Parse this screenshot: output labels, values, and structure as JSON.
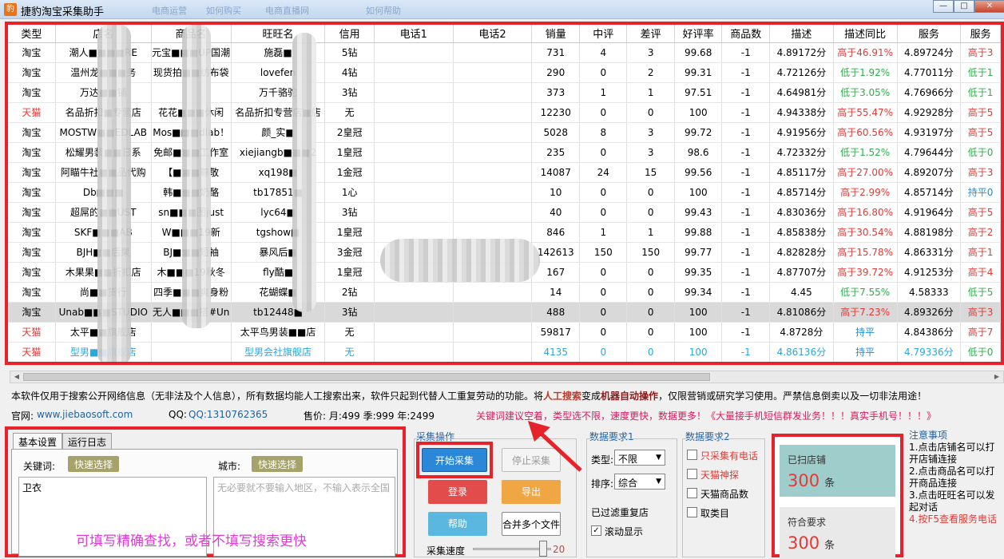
{
  "window": {
    "icon": "app-logo-icon",
    "title": "捷豹淘宝采集助手",
    "ghost_tabs": [
      "电商运营",
      "如何购买",
      "电商直播网",
      "如何帮助"
    ],
    "buttons": {
      "minimize": "—",
      "maximize": "□",
      "close": "✕"
    }
  },
  "grid": {
    "columns": [
      "类型",
      "店名",
      "商品名",
      "旺旺名",
      "信用",
      "电话1",
      "电话2",
      "销量",
      "中评",
      "差评",
      "好评率",
      "商品数",
      "描述",
      "描述同比",
      "服务",
      "服务"
    ],
    "rows": [
      {
        "type": "淘宝",
        "shop": "潮人■■■■RE",
        "product": "元宝■■■UP国潮",
        "wangwang": "施磊■",
        "credit": "5钻",
        "phone1": "",
        "phone2": "",
        "sales": "731",
        "mid": "4",
        "bad": "3",
        "rate": "99.68",
        "count": "-1",
        "desc": "4.89172分",
        "desc_cmp": "高于46.91%",
        "service": "4.89724分",
        "service_cmp": "高于3"
      },
      {
        "type": "淘宝",
        "shop": "温州龙■■■务",
        "product": "现货拍■■纺布袋",
        "wangwang": "lovefen",
        "credit": "4钻",
        "phone1": "",
        "phone2": "",
        "sales": "290",
        "mid": "0",
        "bad": "2",
        "rate": "99.31",
        "count": "-1",
        "desc": "4.72126分",
        "desc_cmp": "低于1.92%",
        "service": "4.77011分",
        "service_cmp": "低于1"
      },
      {
        "type": "淘宝",
        "shop": "万达■■铺",
        "product": "",
        "wangwang": "万千骆驼",
        "credit": "3钻",
        "phone1": "",
        "phone2": "",
        "sales": "373",
        "mid": "1",
        "bad": "1",
        "rate": "97.51",
        "count": "-1",
        "desc": "4.64981分",
        "desc_cmp": "低于3.05%",
        "service": "4.76966分",
        "service_cmp": "低于1"
      },
      {
        "type": "天猫",
        "shop": "名品折扣■专营店",
        "product": "花花■■■休闲",
        "wangwang": "名品折扣专营店■店",
        "credit": "无",
        "phone1": "",
        "phone2": "",
        "sales": "12230",
        "mid": "0",
        "bad": "0",
        "rate": "100",
        "count": "-1",
        "desc": "4.94338分",
        "desc_cmp": "高于55.47%",
        "service": "4.92928分",
        "service_cmp": "高于5"
      },
      {
        "type": "淘宝",
        "shop": "MOSTW■■EDLAB",
        "product": "Mos■■■dlab！",
        "wangwang": "颜_实■",
        "credit": "2皇冠",
        "phone1": "",
        "phone2": "",
        "sales": "5028",
        "mid": "8",
        "bad": "3",
        "rate": "99.72",
        "count": "-1",
        "desc": "4.91956分",
        "desc_cmp": "高于60.56%",
        "service": "4.93197分",
        "service_cmp": "高于5"
      },
      {
        "type": "淘宝",
        "shop": "松耀男装■■日系",
        "product": "免邮■■■工作室",
        "wangwang": "xiejiangb■■■2",
        "credit": "1皇冠",
        "phone1": "",
        "phone2": "",
        "sales": "235",
        "mid": "0",
        "bad": "3",
        "rate": "98.6",
        "count": "-1",
        "desc": "4.72332分",
        "desc_cmp": "低于1.52%",
        "service": "4.79644分",
        "service_cmp": "低于0"
      },
      {
        "type": "淘宝",
        "shop": "阿瞄牛社■■品代购",
        "product": "【■■■尊敬",
        "wangwang": "xq198■",
        "credit": "1金冠",
        "phone1": "",
        "phone2": "",
        "sales": "14087",
        "mid": "24",
        "bad": "15",
        "rate": "99.56",
        "count": "-1",
        "desc": "4.85117分",
        "desc_cmp": "高于27.00%",
        "service": "4.89207分",
        "service_cmp": "高于3"
      },
      {
        "type": "淘宝",
        "shop": "Db■■■",
        "product": "韩■■■奶酪",
        "wangwang": "tb17851■",
        "credit": "1心",
        "phone1": "",
        "phone2": "",
        "sales": "10",
        "mid": "0",
        "bad": "0",
        "rate": "100",
        "count": "-1",
        "desc": "4.85714分",
        "desc_cmp": "高于2.99%",
        "service": "4.85714分",
        "service_cmp": "持平0"
      },
      {
        "type": "淘宝",
        "shop": "超屌的■■UST",
        "product": "sn■■■图just",
        "wangwang": "lyc64■",
        "credit": "3钻",
        "phone1": "",
        "phone2": "",
        "sales": "40",
        "mid": "0",
        "bad": "0",
        "rate": "99.43",
        "count": "-1",
        "desc": "4.83036分",
        "desc_cmp": "高于16.80%",
        "service": "4.91964分",
        "service_cmp": "高于5"
      },
      {
        "type": "淘宝",
        "shop": "SKF■■■AB",
        "product": "W■■■19新",
        "wangwang": "tgshow■",
        "credit": "1皇冠",
        "phone1": "",
        "phone2": "",
        "sales": "846",
        "mid": "1",
        "bad": "1",
        "rate": "99.88",
        "count": "-1",
        "desc": "4.85838分",
        "desc_cmp": "高于30.54%",
        "service": "4.88198分",
        "service_cmp": "高于2"
      },
      {
        "type": "淘宝",
        "shop": "BJH■■后果",
        "product": "BJ■■■短袖",
        "wangwang": "暴风后■",
        "credit": "3金冠",
        "phone1": "",
        "phone2": "",
        "sales": "142613",
        "mid": "150",
        "bad": "150",
        "rate": "99.77",
        "count": "-1",
        "desc": "4.82828分",
        "desc_cmp": "高于15.78%",
        "service": "4.86331分",
        "service_cmp": "高于1"
      },
      {
        "type": "淘宝",
        "shop": "木果果■■折扣店",
        "product": "木■■■19秋冬",
        "wangwang": "fly酷■",
        "credit": "1皇冠",
        "phone1": "",
        "phone2": "",
        "sales": "167",
        "mid": "0",
        "bad": "0",
        "rate": "99.35",
        "count": "-1",
        "desc": "4.87707分",
        "desc_cmp": "高于39.72%",
        "service": "4.91253分",
        "service_cmp": "高于4"
      },
      {
        "type": "淘宝",
        "shop": "尚■■货行",
        "product": "四季■■■爽身粉",
        "wangwang": "花蝴蝶■",
        "credit": "2钻",
        "phone1": "",
        "phone2": "",
        "sales": "14",
        "mid": "0",
        "bad": "0",
        "rate": "99.34",
        "count": "-1",
        "desc": "4.45",
        "desc_cmp": "低于7.55%",
        "service": "4.58333",
        "service_cmp": "低于5"
      },
      {
        "type": "淘宝",
        "shop": "Unab■■■STUDIO",
        "product": "无人■■■搭#Un",
        "wangwang": "tb12448■",
        "credit": "3钻",
        "phone1": "",
        "phone2": "",
        "sales": "488",
        "mid": "0",
        "bad": "0",
        "rate": "100",
        "count": "-1",
        "desc": "4.81086分",
        "desc_cmp": "高于7.23%",
        "service": "4.89326分",
        "service_cmp": "高于3"
      },
      {
        "type": "天猫",
        "shop": "太平■■旗舰店",
        "product": "",
        "wangwang": "太平鸟男装■■店",
        "credit": "无",
        "phone1": "",
        "phone2": "",
        "sales": "59817",
        "mid": "0",
        "bad": "0",
        "rate": "100",
        "count": "-1",
        "desc": "4.8728分",
        "desc_cmp": "持平",
        "service": "4.84386分",
        "service_cmp": "高于7"
      },
      {
        "type": "天猫",
        "shop": "型男■■旗舰店",
        "product": "",
        "wangwang": "型男会社旗舰店",
        "credit": "无",
        "phone1": "",
        "phone2": "",
        "sales": "4135",
        "mid": "0",
        "bad": "0",
        "rate": "100",
        "count": "-1",
        "desc": "4.86136分",
        "desc_cmp": "持平",
        "service": "4.79336分",
        "service_cmp": "低于0"
      }
    ]
  },
  "notice": {
    "part1": "本软件仅用于搜索公开网络信息（无非法及个人信息），所有数据均能人工搜索出来，软件只起到代替人工重复劳动的功能。将",
    "em1": "人工搜索",
    "part2": "变成",
    "em2": "机器自动操作",
    "part3": "，仅限营销或研究学习使用。严禁信息倒卖以及一切非法用途！"
  },
  "info": {
    "site_label": "官网:",
    "site": "www.jiebaosoft.com",
    "qq_label": "QQ:",
    "qq": "QQ:1310762365",
    "price": "售价: 月:499 季:999 年:2499",
    "tip": "关键词建议空着，类型选不限，速度更快，数据更多！《大量接手机短信群发业务！！！真实手机号！！！》"
  },
  "basic": {
    "tabs": [
      "基本设置",
      "运行日志"
    ],
    "keyword_label": "关键词:",
    "quick_select": "快速选择",
    "keyword_value": "卫衣",
    "city_label": "城市:",
    "city_quick_select": "快速选择",
    "city_placeholder": "无必要就不要输入地区，不输入表示全国",
    "hint": "可填写精确查找，或者不填写搜索更快"
  },
  "ops": {
    "title": "采集操作",
    "start": "开始采集",
    "stop": "停止采集",
    "login": "登录",
    "export": "导出",
    "help": "帮助",
    "merge": "合并多个文件",
    "speed_label": "采集速度",
    "speed_value": "20",
    "speed": 0.9
  },
  "req1": {
    "title": "数据要求1",
    "type_label": "类型:",
    "type_value": "不限",
    "sort_label": "排序:",
    "sort_value": "综合",
    "dedup": "已过滤重复店",
    "scroll_label": "滚动显示",
    "scroll_checked": true
  },
  "req2": {
    "title": "数据要求2",
    "options": [
      {
        "label": "只采集有电话",
        "checked": false,
        "color": "#e53935"
      },
      {
        "label": "天猫神探",
        "checked": false,
        "color": "#e53935"
      },
      {
        "label": "天猫商品数",
        "checked": false,
        "color": "#000000"
      },
      {
        "label": "取类目",
        "checked": false,
        "color": "#000000"
      }
    ]
  },
  "stats": {
    "scanned_label": "已扫店铺",
    "scanned_value": "300",
    "matched_label": "符合要求",
    "matched_value": "300",
    "unit": "条"
  },
  "notes": {
    "title": "注意事项",
    "items": [
      "1.点击店铺名可以打开店铺连接",
      "2.点击商品名可以打开商品连接",
      "3.点击旺旺名可以发起对话",
      "4.按F5查看服务电话"
    ]
  },
  "colors": {
    "highlight": "#e6232a",
    "up": "#e53935",
    "down": "#2fb04a",
    "tmall": "#e53935"
  }
}
